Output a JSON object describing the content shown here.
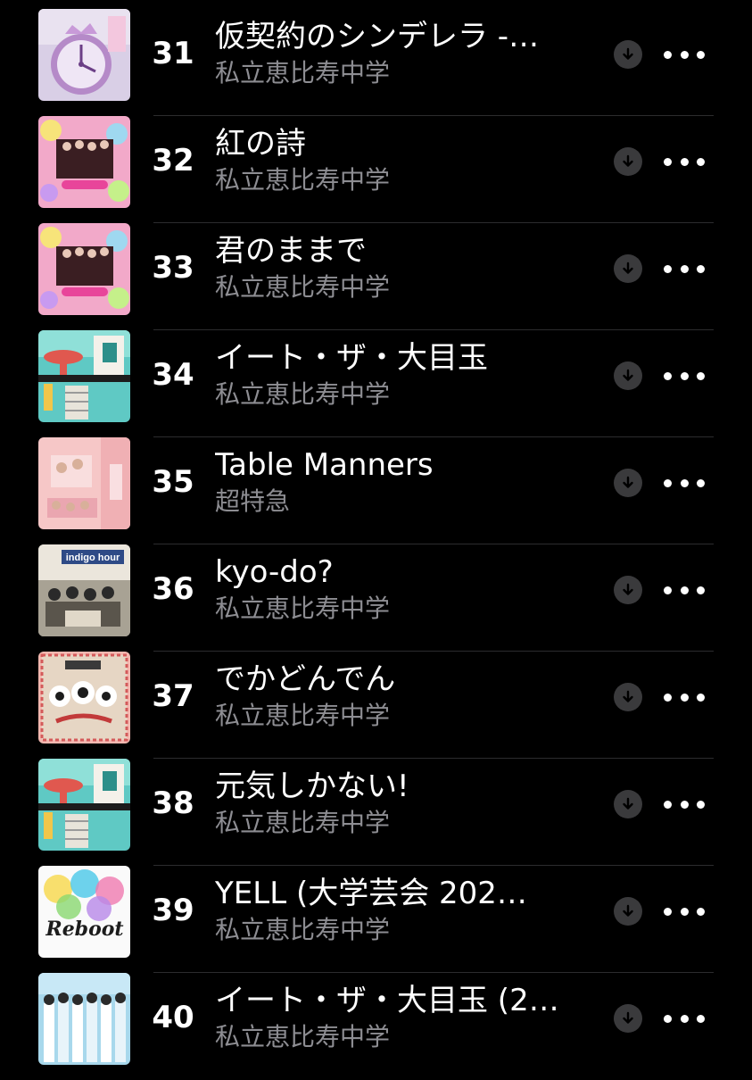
{
  "colors": {
    "background": "#000000",
    "title_text": "#ffffff",
    "artist_text": "#8d8d92",
    "download_button": "#3a3a3c",
    "separator": "#2c2c2e"
  },
  "tracks": [
    {
      "rank": "31",
      "title": "仮契約のシンデレラ -…",
      "artist": "私立恵比寿中学"
    },
    {
      "rank": "32",
      "title": "紅の詩",
      "artist": "私立恵比寿中学"
    },
    {
      "rank": "33",
      "title": "君のままで",
      "artist": "私立恵比寿中学"
    },
    {
      "rank": "34",
      "title": "イート・ザ・大目玉",
      "artist": "私立恵比寿中学"
    },
    {
      "rank": "35",
      "title": "Table Manners",
      "artist": "超特急"
    },
    {
      "rank": "36",
      "title": "kyo-do?",
      "artist": "私立恵比寿中学"
    },
    {
      "rank": "37",
      "title": "でかどんでん",
      "artist": "私立恵比寿中学"
    },
    {
      "rank": "38",
      "title": "元気しかない!",
      "artist": "私立恵比寿中学"
    },
    {
      "rank": "39",
      "title": "YELL (大学芸会 202…",
      "artist": "私立恵比寿中学"
    },
    {
      "rank": "40",
      "title": "イート・ザ・大目玉 (2…",
      "artist": "私立恵比寿中学"
    }
  ],
  "icons": {
    "download": "arrow-down-circle-icon",
    "more": "ellipsis-icon"
  },
  "artwork_logos": {
    "row_36": "indigo hour",
    "row_39": "Reboot"
  }
}
